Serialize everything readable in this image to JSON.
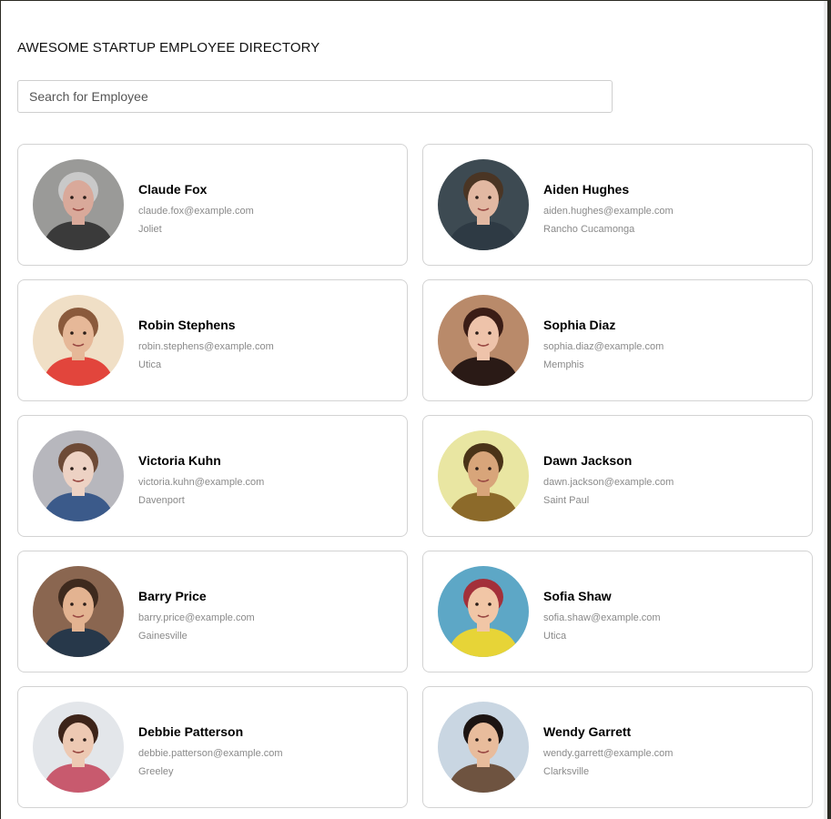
{
  "header": {
    "title": "AWESOME STARTUP EMPLOYEE DIRECTORY"
  },
  "search": {
    "placeholder": "Search for Employee",
    "value": ""
  },
  "employees": [
    {
      "name": "Claude Fox",
      "email": "claude.fox@example.com",
      "city": "Joliet",
      "bg": "#9a9a98",
      "skin": "#d9a99a",
      "hair": "#c9c9c9",
      "shirt": "#3a3a3a"
    },
    {
      "name": "Aiden Hughes",
      "email": "aiden.hughes@example.com",
      "city": "Rancho Cucamonga",
      "bg": "#3d4a52",
      "skin": "#e2b8a2",
      "hair": "#4a3524",
      "shirt": "#2e3a44"
    },
    {
      "name": "Robin Stephens",
      "email": "robin.stephens@example.com",
      "city": "Utica",
      "bg": "#f0dfc6",
      "skin": "#e6b898",
      "hair": "#8a5a3c",
      "shirt": "#e2453c"
    },
    {
      "name": "Sophia Diaz",
      "email": "sophia.diaz@example.com",
      "city": "Memphis",
      "bg": "#b98a6a",
      "skin": "#eec3aa",
      "hair": "#3b1d16",
      "shirt": "#2a1a16"
    },
    {
      "name": "Victoria Kuhn",
      "email": "victoria.kuhn@example.com",
      "city": "Davenport",
      "bg": "#b7b7bd",
      "skin": "#edd2c4",
      "hair": "#6d4a36",
      "shirt": "#3b5a8a"
    },
    {
      "name": "Dawn Jackson",
      "email": "dawn.jackson@example.com",
      "city": "Saint Paul",
      "bg": "#e9e6a2",
      "skin": "#d8a57a",
      "hair": "#4a3318",
      "shirt": "#8c6a2a"
    },
    {
      "name": "Barry Price",
      "email": "barry.price@example.com",
      "city": "Gainesville",
      "bg": "#8a6650",
      "skin": "#e3b391",
      "hair": "#3e2a1e",
      "shirt": "#27384a"
    },
    {
      "name": "Sofia Shaw",
      "email": "sofia.shaw@example.com",
      "city": "Utica",
      "bg": "#5da7c6",
      "skin": "#f1c6a6",
      "hair": "#a3303a",
      "shirt": "#e7d437"
    },
    {
      "name": "Debbie Patterson",
      "email": "debbie.patterson@example.com",
      "city": "Greeley",
      "bg": "#e3e6ea",
      "skin": "#edc9b3",
      "hair": "#3d2419",
      "shirt": "#c85a6e"
    },
    {
      "name": "Wendy Garrett",
      "email": "wendy.garrett@example.com",
      "city": "Clarksville",
      "bg": "#c9d6e2",
      "skin": "#e8bc9c",
      "hair": "#1c1412",
      "shirt": "#6e5340"
    }
  ]
}
